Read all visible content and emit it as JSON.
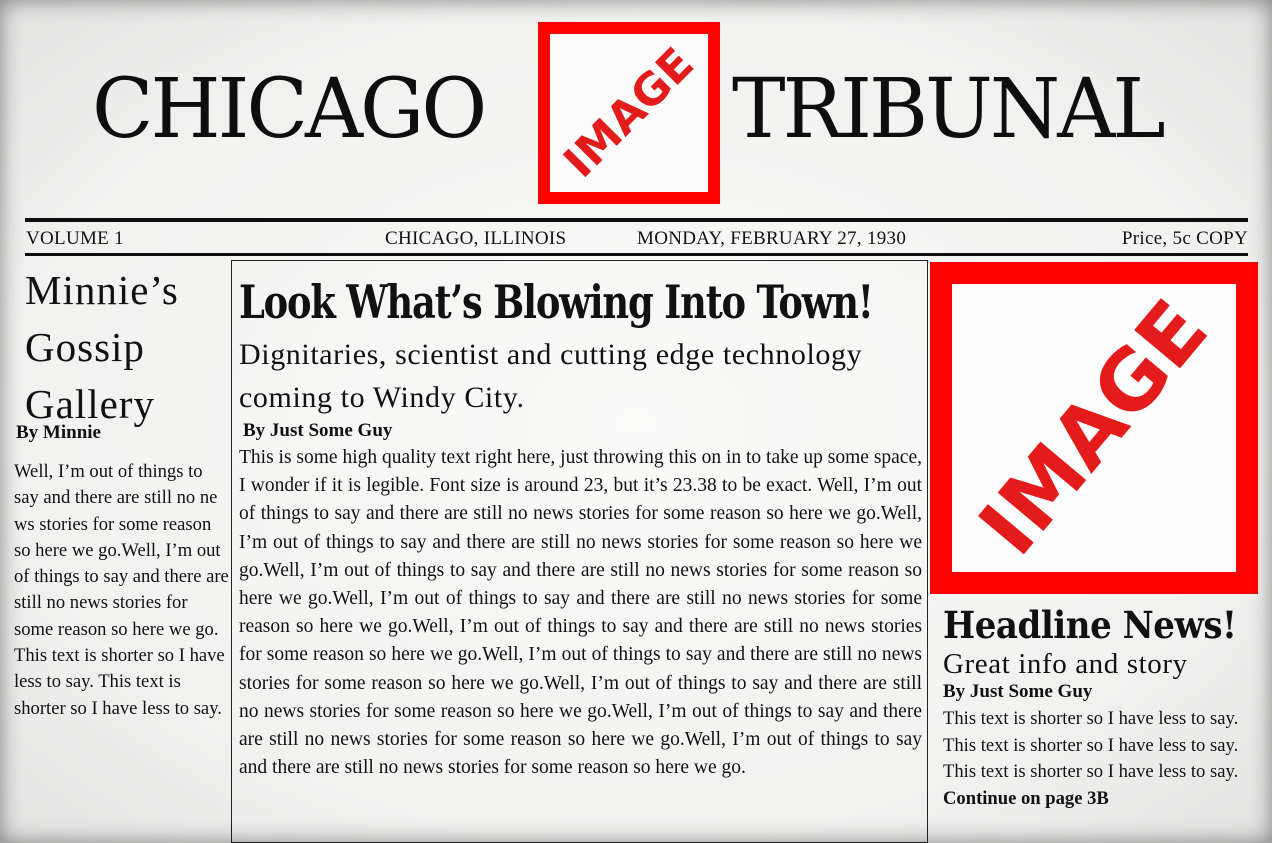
{
  "masthead": {
    "left_word": "CHICAGO",
    "right_word": "TRIBUNAL",
    "logo_text": "IMAGE"
  },
  "dateline": {
    "volume": "VOLUME 1",
    "location": "CHICAGO, ILLINOIS",
    "date": "MONDAY, FEBRUARY 27, 1930",
    "price": "Price, 5c COPY"
  },
  "left_column": {
    "title_line1": "Minnie’s",
    "title_line2": "Gossip",
    "title_line3": "Gallery",
    "byline": "By Minnie",
    "body": "Well, I’m out of things to say and there are still no ne ws stories for some reason so here we go.Well, I’m out of things to say and there are still no news stories for some reason so here we go. This text is shorter so I have less to say. This text is shorter so I have less to say."
  },
  "main_story": {
    "headline": "Look What’s Blowing Into Town!",
    "subhead": "Dignitaries, scientist and cutting edge technology coming to Windy City.",
    "byline": "By Just Some Guy",
    "body": "This is some high quality text right here, just throwing this on in to take up some space, I wonder if it is legible. Font size is around 23, but it’s 23.38 to be exact. Well, I’m out of things to say and there are still no news stories for some reason so here we go.Well, I’m out of things to say and there are still no news stories for some reason so here we go.Well, I’m out of things to say and there are still no news stories for some reason so here we go.Well, I’m out of things to say and there are still no news stories for some reason so here we go.Well, I’m out of things to say and there are still no news stories for some reason so here we go.Well, I’m out of things to say and there are still no news stories for some reason so here we go.Well, I’m out of things to say and there are still no news stories for some reason so here we go.Well, I’m out of things to say and there are still no news stories for some reason so here we go.Well, I’m out of things to say and there are still no news stories for some reason so here we go."
  },
  "right_image": {
    "text": "IMAGE"
  },
  "right_story": {
    "headline": "Headline News!",
    "subhead": "Great info and story",
    "byline": "By Just Some Guy",
    "body": "This text is shorter so I have less to say. This text is shorter so I have less to say. This text is shorter so I have less to say.",
    "continue": "Continue on page 3B"
  },
  "colors": {
    "accent_red": "#ff0000",
    "ink": "#111111",
    "paper": "#f3f3f2"
  }
}
